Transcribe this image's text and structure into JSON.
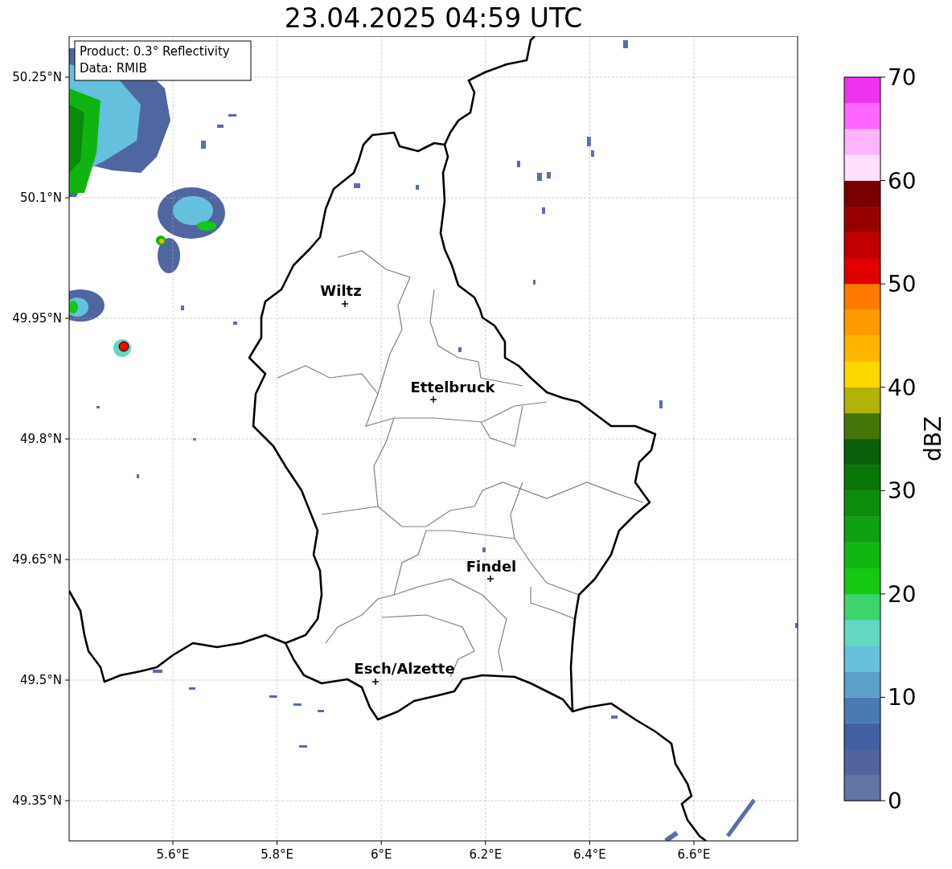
{
  "title": "23.04.2025 04:59 UTC",
  "info_box": [
    "Product: 0.3° Reflectivity",
    "Data: RMIB"
  ],
  "cities": [
    "Wiltz",
    "Ettelbruck",
    "Findel",
    "Esch/Alzette"
  ],
  "x_ticks": [
    "5.6°E",
    "5.8°E",
    "6°E",
    "6.2°E",
    "6.4°E",
    "6.6°E"
  ],
  "y_ticks": [
    "50.25°N",
    "50.1°N",
    "49.95°N",
    "49.8°N",
    "49.65°N",
    "49.5°N",
    "49.35°N"
  ],
  "colorbar": {
    "label": "dBZ",
    "ticks": [
      "70",
      "60",
      "50",
      "40",
      "30",
      "20",
      "10",
      "0"
    ],
    "segments": [
      {
        "color": "#6374a6"
      },
      {
        "color": "#51649e"
      },
      {
        "color": "#4360a2"
      },
      {
        "color": "#4a7ab2"
      },
      {
        "color": "#5ba0c8"
      },
      {
        "color": "#66c2dc"
      },
      {
        "color": "#62d8c0"
      },
      {
        "color": "#3dd46c"
      },
      {
        "color": "#14c814"
      },
      {
        "color": "#11b611"
      },
      {
        "color": "#0fa00f"
      },
      {
        "color": "#0c8c0c"
      },
      {
        "color": "#0a760a"
      },
      {
        "color": "#095e09"
      },
      {
        "color": "#457508"
      },
      {
        "color": "#b2b208"
      },
      {
        "color": "#ffd700"
      },
      {
        "color": "#ffb600"
      },
      {
        "color": "#ff9a00"
      },
      {
        "color": "#ff7a00"
      },
      {
        "color": "#e00000"
      },
      {
        "color": "#c00000"
      },
      {
        "color": "#9b0000"
      },
      {
        "color": "#780000"
      },
      {
        "color": "#ffe0ff"
      },
      {
        "color": "#ffb3ff"
      },
      {
        "color": "#ff66ff"
      },
      {
        "color": "#ee33ee"
      }
    ]
  }
}
